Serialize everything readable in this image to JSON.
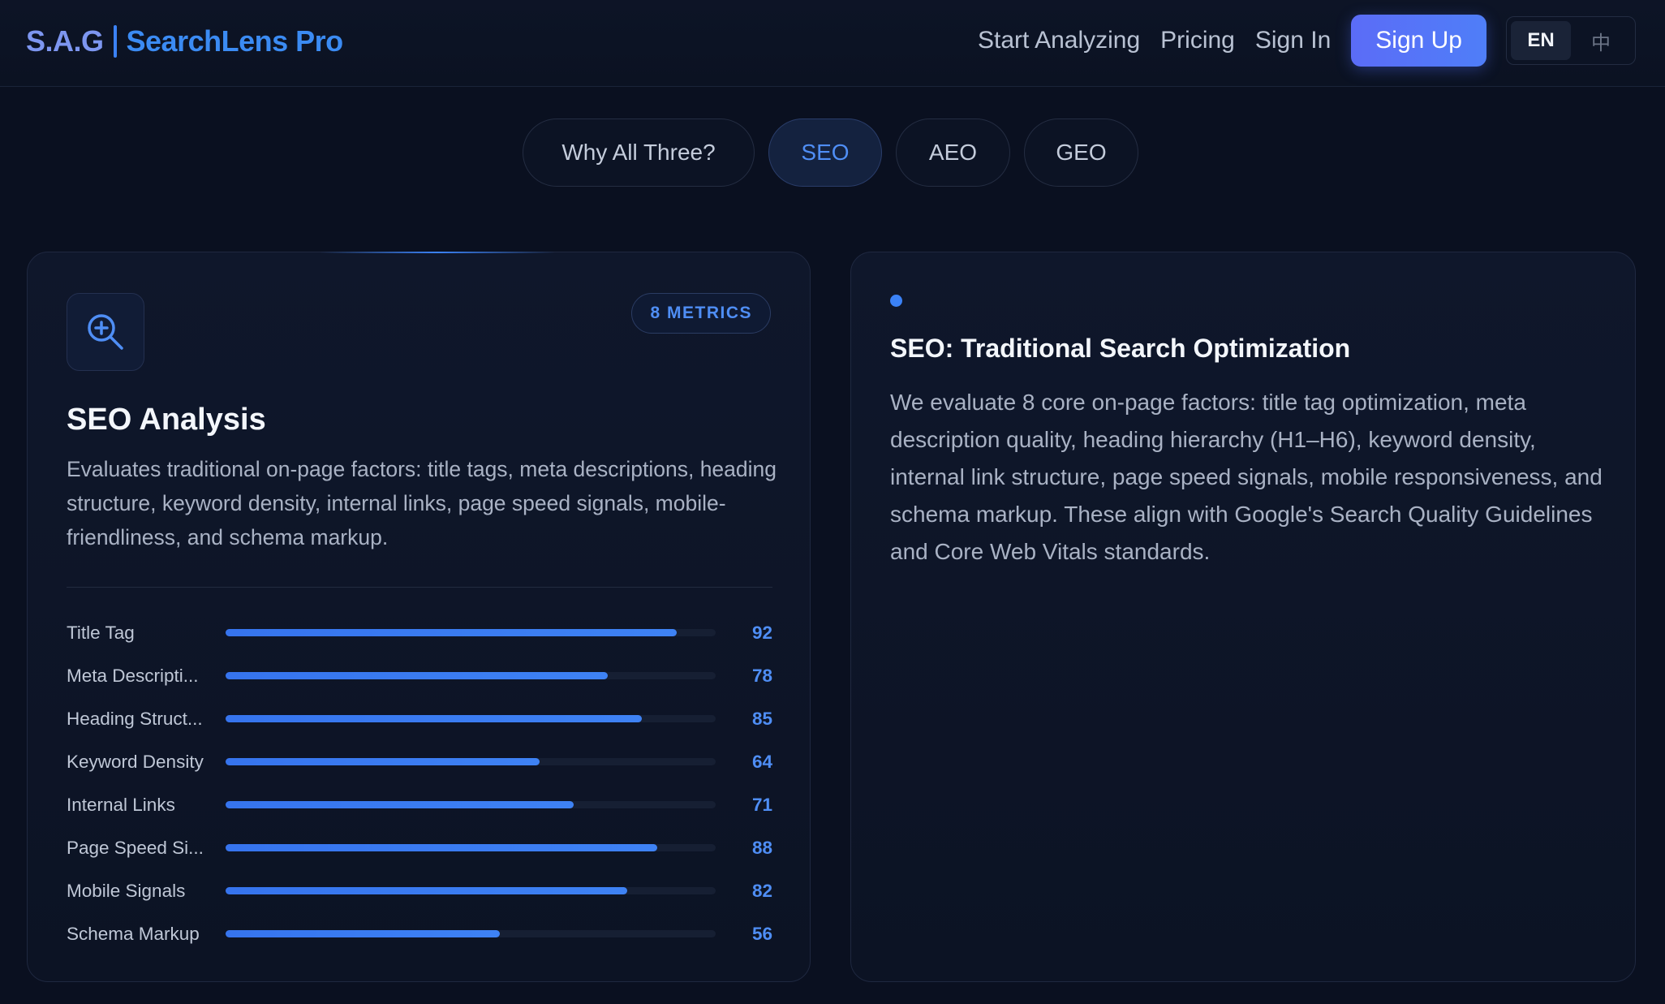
{
  "header": {
    "brand_short": "S.A.G",
    "brand_product": "SearchLens Pro",
    "nav": [
      "Start Analyzing",
      "Pricing",
      "Sign In"
    ],
    "signup": "Sign Up",
    "lang_en": "EN",
    "lang_zh": "中"
  },
  "tabs": [
    {
      "label": "Why All Three?",
      "active": false
    },
    {
      "label": "SEO",
      "active": true
    },
    {
      "label": "AEO",
      "active": false
    },
    {
      "label": "GEO",
      "active": false
    }
  ],
  "analysis_card": {
    "icon": "zoom-in-icon",
    "badge": "8 METRICS",
    "title": "SEO Analysis",
    "description": "Evaluates traditional on-page factors: title tags, meta descriptions, heading structure, keyword density, internal links, page speed signals, mobile-friendliness, and schema markup.",
    "metrics": [
      {
        "label": "Title Tag",
        "value": 92
      },
      {
        "label": "Meta Descripti...",
        "value": 78
      },
      {
        "label": "Heading Struct...",
        "value": 85
      },
      {
        "label": "Keyword Density",
        "value": 64
      },
      {
        "label": "Internal Links",
        "value": 71
      },
      {
        "label": "Page Speed Si...",
        "value": 88
      },
      {
        "label": "Mobile Signals",
        "value": 82
      },
      {
        "label": "Schema Markup",
        "value": 56
      }
    ]
  },
  "detail_card": {
    "title": "SEO: Traditional Search Optimization",
    "body": "We evaluate 8 core on-page factors: title tag optimization, meta description quality, heading hierarchy (H1–H6), keyword density, internal link structure, page speed signals, mobile responsiveness, and schema markup. These align with Google's Search Quality Guidelines and Core Web Vitals standards."
  },
  "colors": {
    "accent": "#3b82f6",
    "background": "#0a1020"
  }
}
